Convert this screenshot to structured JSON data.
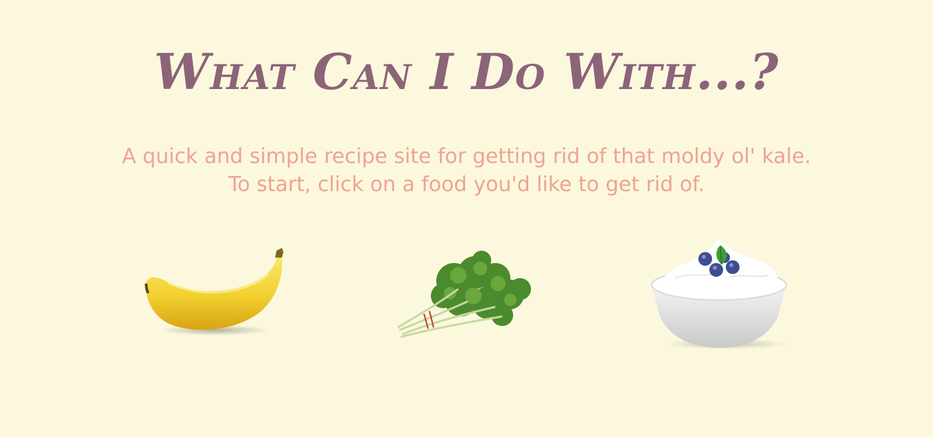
{
  "header": {
    "title": "What Can I Do With...?"
  },
  "intro": {
    "line1": "A quick and simple recipe site for getting rid of that moldy ol' kale.",
    "line2": "To start, click on a food you'd like to get rid of."
  },
  "foods": [
    {
      "name": "banana",
      "icon": "banana-image"
    },
    {
      "name": "kale",
      "icon": "kale-image"
    },
    {
      "name": "yogurt",
      "icon": "yogurt-image"
    }
  ],
  "colors": {
    "background": "#fcf8de",
    "title": "#8b6478",
    "subtitle": "#eea393"
  }
}
